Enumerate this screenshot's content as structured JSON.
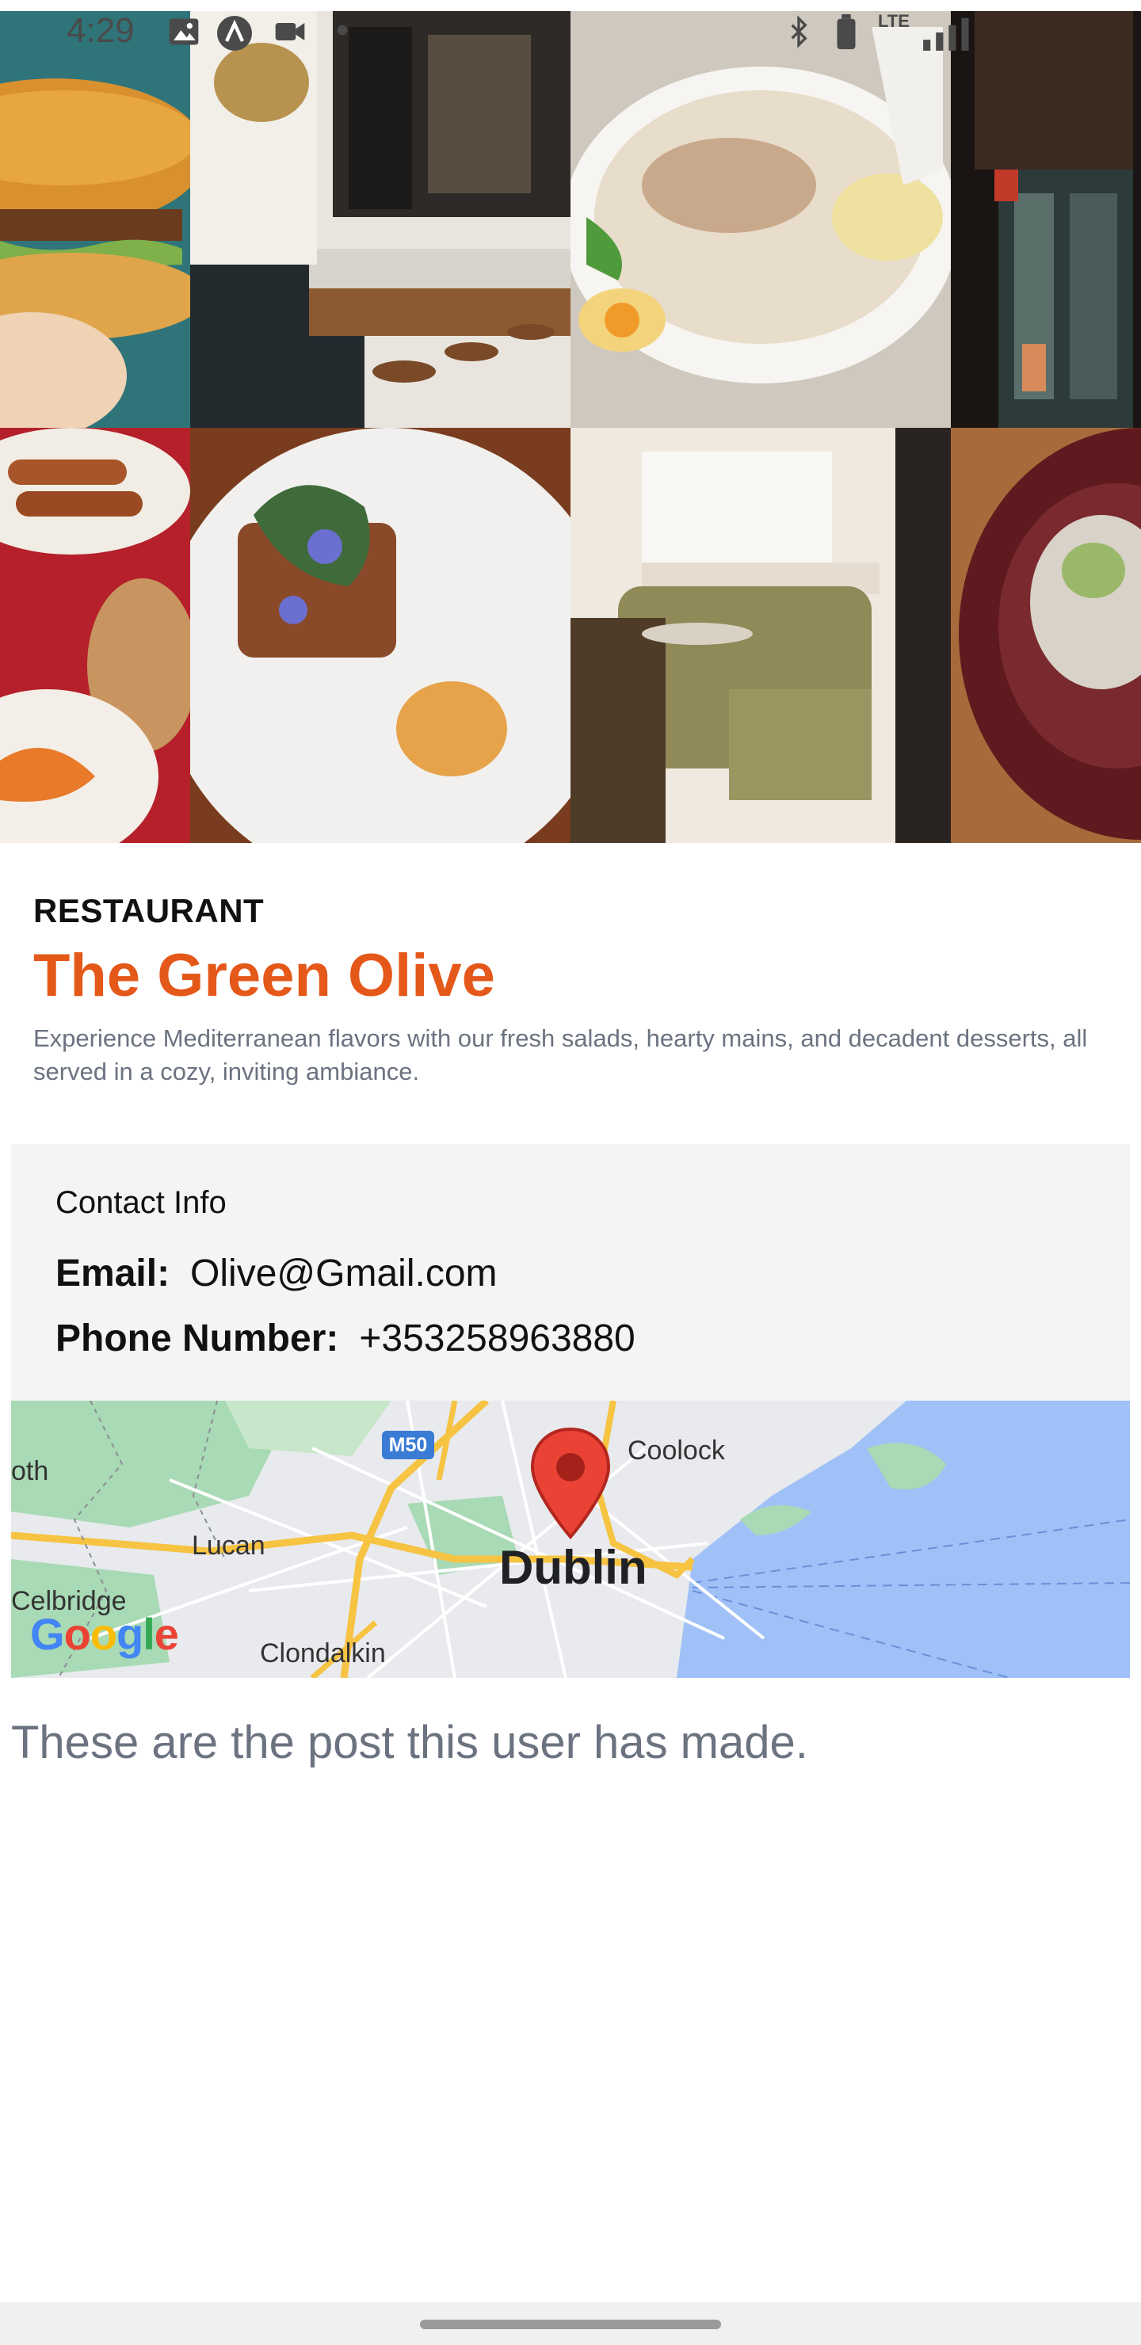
{
  "status_bar": {
    "time": "4:29",
    "network": "LTE"
  },
  "hero": {
    "tiles": [
      {
        "alt": "Burger"
      },
      {
        "alt": "Bar interior"
      },
      {
        "alt": "Ramen bowl"
      },
      {
        "alt": "Restaurant exterior"
      },
      {
        "alt": "Sausage plate"
      },
      {
        "alt": "Plated dish"
      },
      {
        "alt": "Dining booth"
      },
      {
        "alt": "Oysters"
      }
    ]
  },
  "restaurant": {
    "category": "RESTAURANT",
    "name": "The Green Olive",
    "description": "Experience Mediterranean flavors with our fresh salads, hearty mains, and decadent desserts, all served in a cozy, inviting ambiance."
  },
  "contact": {
    "title": "Contact Info",
    "email_label": "Email:",
    "email": "Olive@Gmail.com",
    "phone_label": "Phone Number:",
    "phone": "+353258963880"
  },
  "map": {
    "city": "Dublin",
    "labels": {
      "coolock": "Coolock",
      "lucan": "Lucan",
      "clondalkin": "Clondalkin",
      "celbridge": "Celbridge",
      "oth": "oth",
      "m50": "M50"
    },
    "google": [
      "G",
      "o",
      "o",
      "g",
      "l",
      "e"
    ]
  },
  "posts": {
    "heading": "These are the post this user has made."
  },
  "colors": {
    "accent": "#e4581a",
    "card_bg": "#f3f4f6",
    "muted_text": "#6b7280"
  }
}
